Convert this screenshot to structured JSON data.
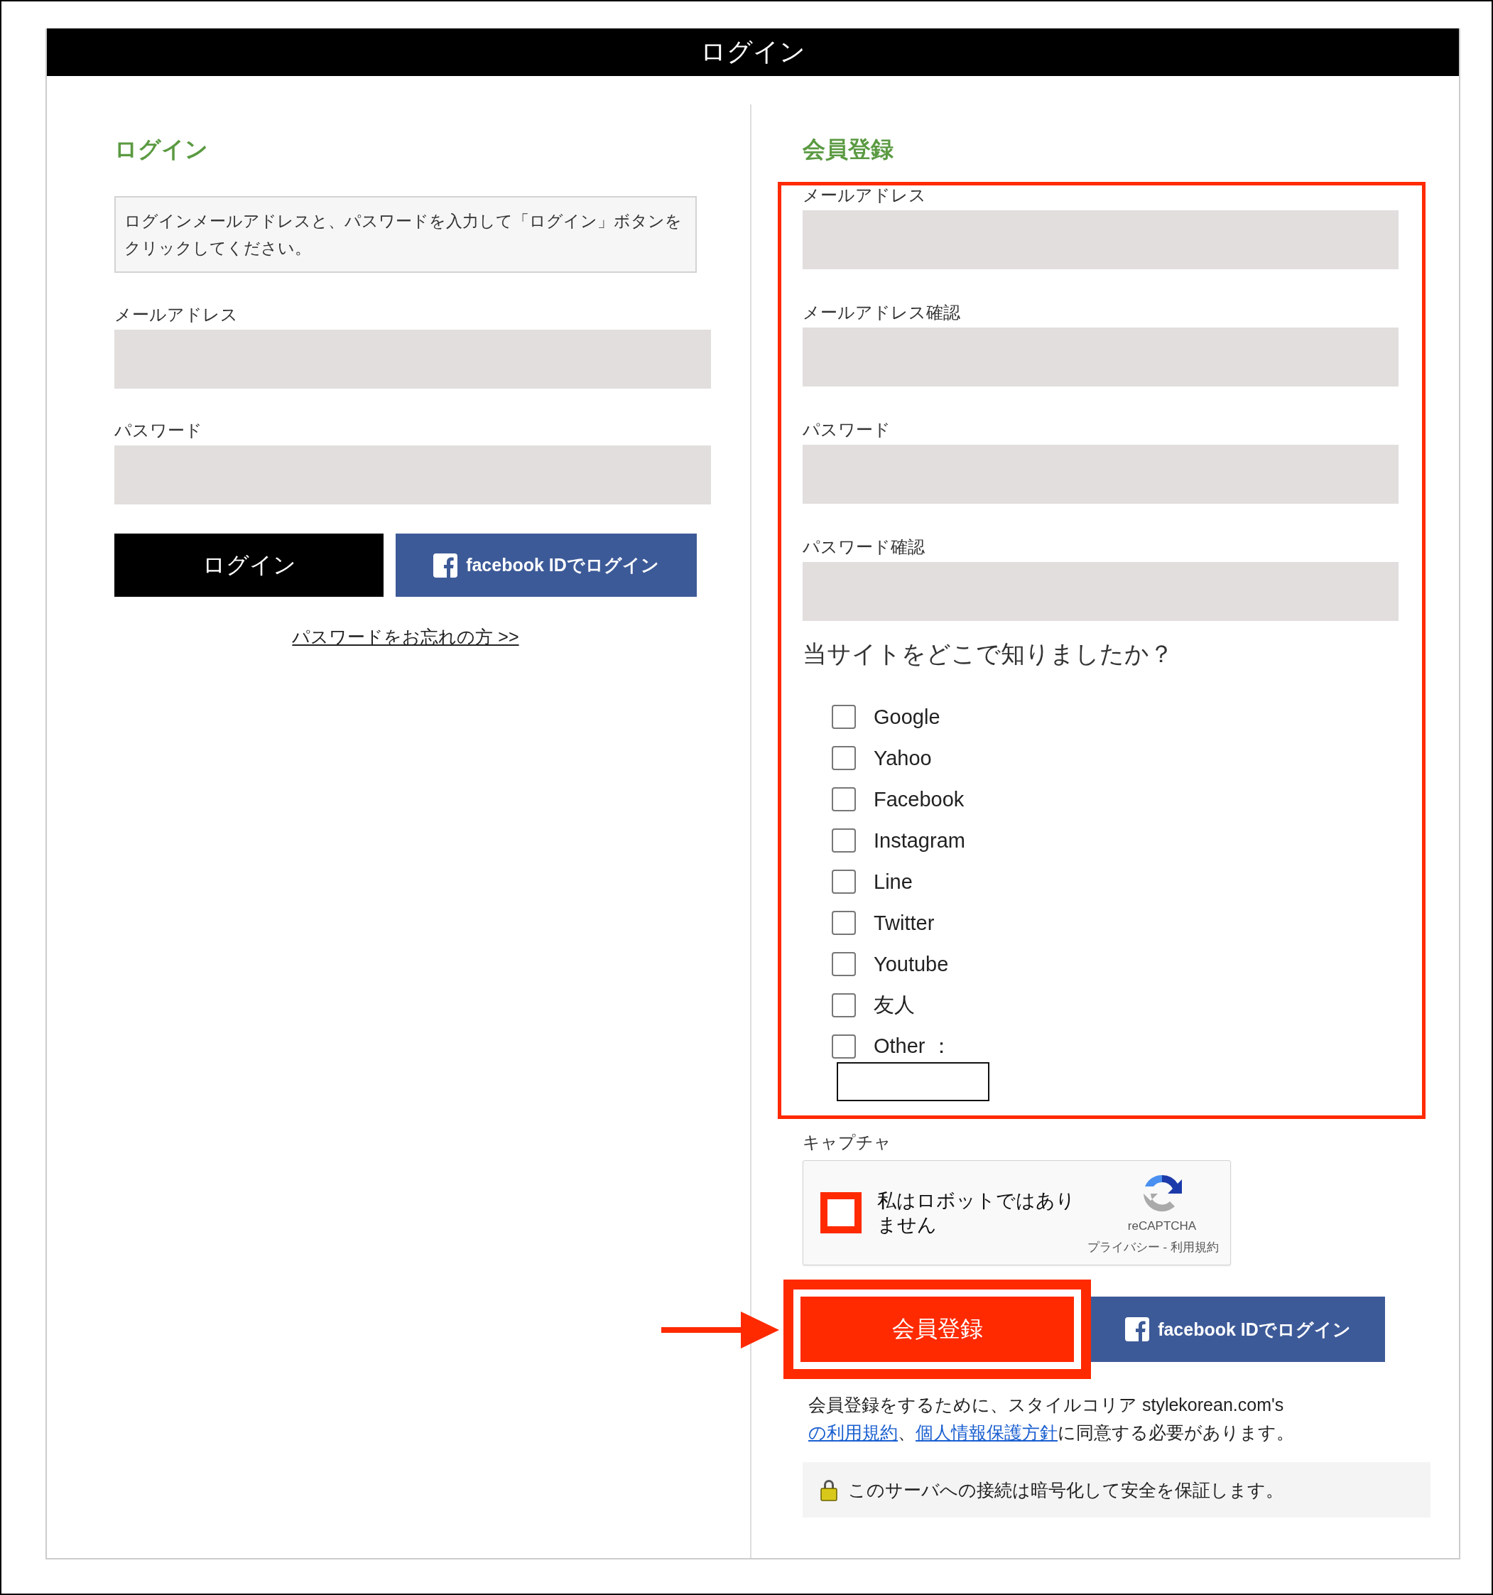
{
  "header": {
    "title": "ログイン"
  },
  "login": {
    "heading": "ログイン",
    "notice": "ログインメールアドレスと、パスワードを入力して「ログイン」ボタンをクリックしてください。",
    "fields": [
      {
        "label": "メールアドレス"
      },
      {
        "label": "パスワード"
      }
    ],
    "buttons": [
      {
        "label": "ログイン",
        "kind": "primary"
      },
      {
        "label": "facebook IDでログイン",
        "kind": "facebook"
      }
    ],
    "forgot_link": "パスワードをお忘れの方 >>"
  },
  "register": {
    "heading": "会員登録",
    "fields": [
      {
        "label": "メールアドレス"
      },
      {
        "label": "メールアドレス確認"
      },
      {
        "label": "パスワード"
      },
      {
        "label": "パスワード確認"
      }
    ],
    "question": "当サイトをどこで知りましたか？",
    "options": [
      {
        "label": "Google",
        "checked": false,
        "kind": "plain"
      },
      {
        "label": "Yahoo",
        "checked": false,
        "kind": "plain"
      },
      {
        "label": "Facebook",
        "checked": false,
        "kind": "plain"
      },
      {
        "label": "Instagram",
        "checked": false,
        "kind": "plain"
      },
      {
        "label": "Line",
        "checked": false,
        "kind": "plain"
      },
      {
        "label": "Twitter",
        "checked": false,
        "kind": "plain"
      },
      {
        "label": "Youtube",
        "checked": false,
        "kind": "plain"
      },
      {
        "label": "友人",
        "checked": false,
        "kind": "plain"
      },
      {
        "label": "Other ：",
        "checked": false,
        "kind": "other"
      }
    ],
    "captcha": {
      "label": "キャプチャ",
      "text": "私はロボットではありません",
      "checked": false,
      "brand": "reCAPTCHA",
      "footer": "プライバシー - 利用規約"
    },
    "buttons": [
      {
        "label": "会員登録",
        "kind": "register"
      },
      {
        "label": "facebook IDでログイン",
        "kind": "facebook"
      }
    ],
    "terms": [
      {
        "text": "会員登録をするために、スタイルコリア stylekorean.com's ",
        "kind": "plain"
      },
      {
        "text": "の利用規約",
        "kind": "link"
      },
      {
        "text": "、",
        "kind": "plain"
      },
      {
        "text": "個人情報保護方針",
        "kind": "link"
      },
      {
        "text": "に同意する必要があります。",
        "kind": "plain"
      }
    ],
    "secure_note": "このサーバへの接続は暗号化して安全を保証します。"
  }
}
